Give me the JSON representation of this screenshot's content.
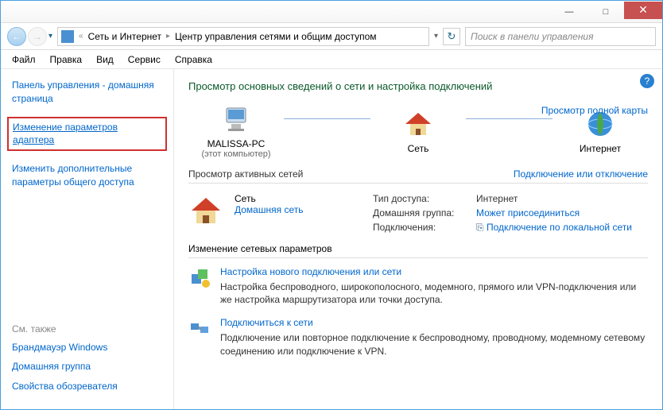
{
  "titlebar": {
    "min": "—",
    "max": "□",
    "close": "✕"
  },
  "addr": {
    "back": "←",
    "fwd": "→",
    "drop": "▾",
    "refresh": "↻",
    "chev": "«",
    "sep": "▸",
    "crumb1": "Сеть и Интернет",
    "crumb2": "Центр управления сетями и общим доступом",
    "search_ph": "Поиск в панели управления"
  },
  "menu": {
    "file": "Файл",
    "edit": "Правка",
    "view": "Вид",
    "tools": "Сервис",
    "help": "Справка"
  },
  "sidebar": {
    "home": "Панель управления - домашняя страница",
    "adapter": "Изменение параметров адаптера",
    "sharing": "Изменить дополнительные параметры общего доступа",
    "see_also": "См. также",
    "firewall": "Брандмауэр Windows",
    "homegroup": "Домашняя группа",
    "ie": "Свойства обозревателя"
  },
  "main": {
    "help": "?",
    "title": "Просмотр основных сведений о сети и настройка подключений",
    "maplink": "Просмотр полной карты",
    "node1": "MALISSA-PC",
    "node1sub": "(этот компьютер)",
    "node2": "Сеть",
    "node3": "Интернет",
    "active_header": "Просмотр активных сетей",
    "connect_link": "Подключение или отключение",
    "net_name": "Сеть",
    "net_type": "Домашняя сеть",
    "k_access": "Тип доступа:",
    "v_access": "Интернет",
    "k_hg": "Домашняя группа:",
    "v_hg": "Может присоединиться",
    "k_conn": "Подключения:",
    "v_conn": "Подключение по локальной сети",
    "change_header": "Изменение сетевых параметров",
    "opt1_t": "Настройка нового подключения или сети",
    "opt1_d": "Настройка беспроводного, широкополосного, модемного, прямого или VPN-подключения или же настройка маршрутизатора или точки доступа.",
    "opt2_t": "Подключиться к сети",
    "opt2_d": "Подключение или повторное подключение к беспроводному, проводному, модемному сетевому соединению или подключение к VPN."
  }
}
